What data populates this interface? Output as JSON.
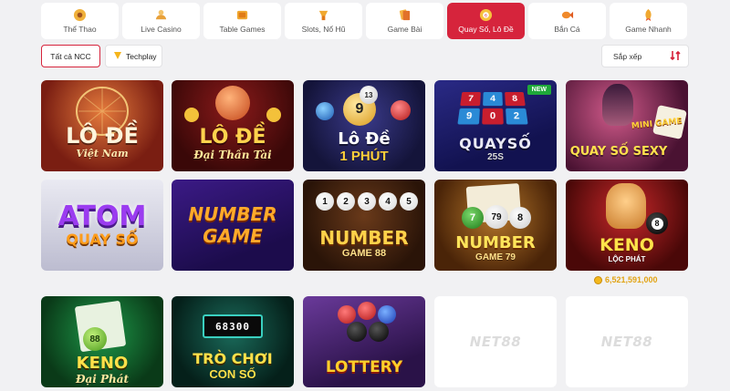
{
  "tabs": [
    {
      "label": "Thể Thao",
      "icon": "soccer-ball-icon",
      "active": false
    },
    {
      "label": "Live Casino",
      "icon": "dealer-icon",
      "active": false
    },
    {
      "label": "Table Games",
      "icon": "table-games-icon",
      "active": false
    },
    {
      "label": "Slots, Nổ Hũ",
      "icon": "slot-machine-icon",
      "active": false
    },
    {
      "label": "Game Bài",
      "icon": "cards-icon",
      "active": false
    },
    {
      "label": "Quay Số, Lô Đề",
      "icon": "lottery-ball-icon",
      "active": true
    },
    {
      "label": "Bắn Cá",
      "icon": "fish-icon",
      "active": false
    },
    {
      "label": "Game Nhanh",
      "icon": "rocket-icon",
      "active": false
    }
  ],
  "filters": {
    "all_label": "Tất cả NCC",
    "provider_label": "Techplay",
    "sort_label": "Sắp xếp"
  },
  "games": [
    {
      "line1": "LÔ ĐỀ",
      "line2": "Việt Nam",
      "badge": ""
    },
    {
      "line1": "LÔ ĐỀ",
      "line2": "Đại Thần Tài",
      "badge": ""
    },
    {
      "line1": "Lô Đề",
      "line2": "1 PHÚT",
      "badge": ""
    },
    {
      "line1": "QUAYSỐ",
      "line2": "25S",
      "badge": "NEW"
    },
    {
      "line1": "QUAY SỐ SEXY",
      "line2": "MINI GAME",
      "badge": ""
    },
    {
      "line1": "ATOM",
      "line2": "QUAY SỐ",
      "badge": ""
    },
    {
      "line1": "NUMBER",
      "line2": "GAME",
      "badge": ""
    },
    {
      "line1": "NUMBER",
      "line2": "GAME 88",
      "badge": ""
    },
    {
      "line1": "NUMBER",
      "line2": "GAME 79",
      "badge": ""
    },
    {
      "line1": "KENO",
      "line2": "LỘC PHÁT",
      "badge": ""
    },
    {
      "line1": "KENO",
      "line2": "Đại Phát",
      "badge": ""
    },
    {
      "line1": "TRÒ CHƠI",
      "line2": "CON SỐ",
      "badge": ""
    },
    {
      "line1": "LOTTERY",
      "line2": "",
      "badge": ""
    },
    {
      "line1": "NET88",
      "line2": "",
      "badge": ""
    },
    {
      "line1": "NET88",
      "line2": "",
      "badge": ""
    }
  ],
  "ball_numbers": {
    "lode1phut": [
      "9",
      "13"
    ],
    "quayso": [
      "7",
      "4",
      "8",
      "9",
      "0",
      "2"
    ],
    "ng88": [
      "1",
      "2",
      "3",
      "4",
      "5"
    ],
    "ng79": [
      "7",
      "79",
      "8"
    ],
    "keno_dai_phat": "88",
    "tro_choi_display": "68300",
    "keno_loc_phat_ball": "8"
  },
  "jackpot": {
    "amount": "6,521,591,000"
  },
  "colors": {
    "accent": "#d6243c",
    "jackpot": "#e2a415",
    "card_placeholder": "#ffffff"
  }
}
